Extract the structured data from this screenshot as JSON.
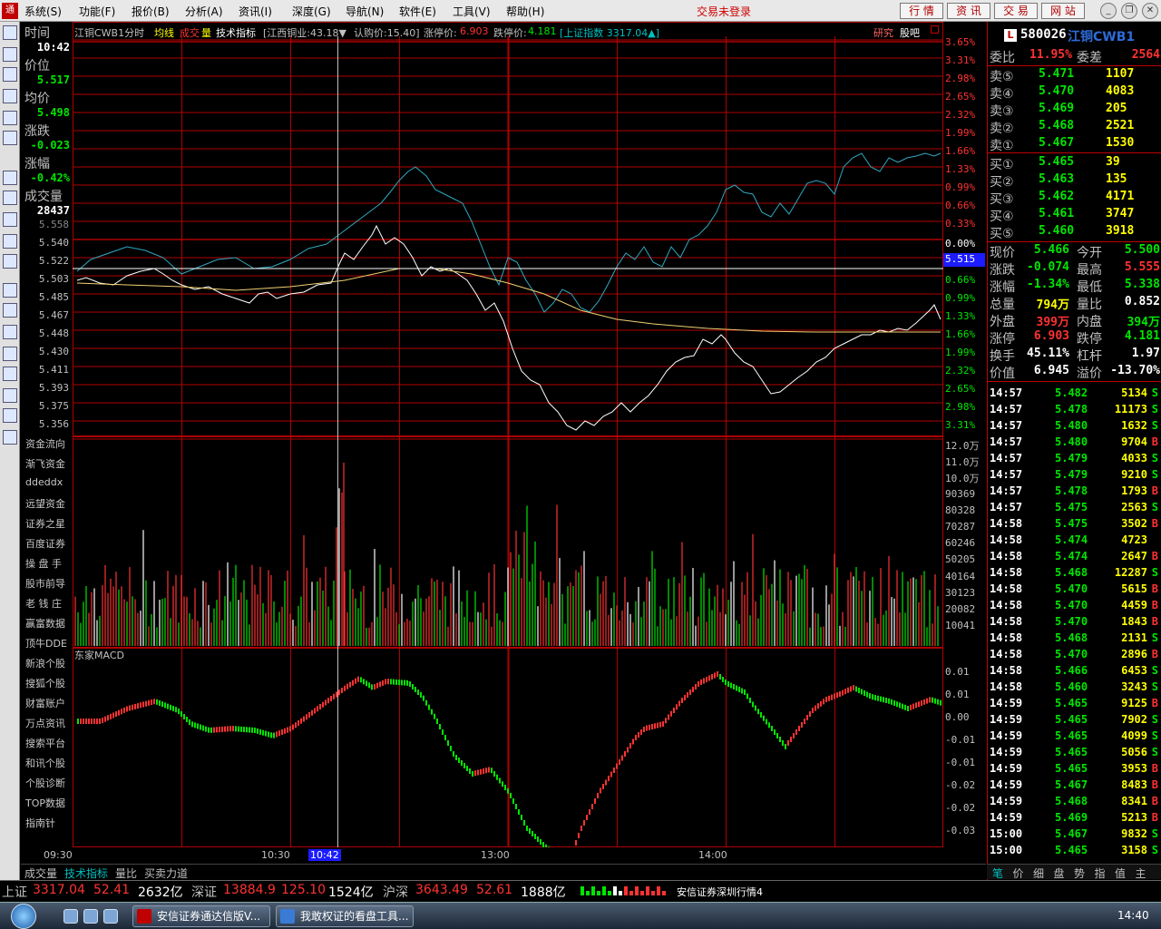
{
  "menubar": {
    "app_icon": "通",
    "items": [
      "系统(S)",
      "功能(F)",
      "报价(B)",
      "分析(A)",
      "资讯(I)",
      "深度(G)",
      "导航(N)",
      "软件(E)",
      "工具(V)",
      "帮助(H)"
    ],
    "trade_status": "交易未登录",
    "toolbar_buttons": [
      "行 情",
      "资 讯",
      "交 易",
      "网 站"
    ],
    "window_icons": [
      "minimize-icon",
      "restore-icon",
      "close-icon"
    ]
  },
  "colors": {
    "red": "#ff3232",
    "green": "#00e600",
    "yellow": "#ffff00",
    "white": "#ffffff",
    "cyan": "#00c0c0",
    "grid": "#b00000",
    "bg": "#000000"
  },
  "left_toolbar_icons": [
    "quote-icon",
    "list-icon",
    "minute-chart-icon",
    "kline-icon",
    "f10-icon",
    "report-icon",
    "mail-icon",
    "users-icon",
    "formula-icon",
    "search-icon",
    "etf-icon",
    "trend-icon",
    "compare-icon",
    "wave-icon",
    "percent-icon",
    "export-icon",
    "pen-icon",
    "up-arrow-icon",
    "down-arrow-icon"
  ],
  "side_values": [
    {
      "label": "时间",
      "value": "10:42"
    },
    {
      "label": "价位",
      "value": "5.517"
    },
    {
      "label": "均价",
      "value": "5.498"
    },
    {
      "label": "涨跌",
      "value": "-0.023"
    },
    {
      "label": "涨幅",
      "value": "-0.42%"
    },
    {
      "label": "成交量",
      "value": "28437"
    }
  ],
  "price_axis": [
    "5.558",
    "5.540",
    "5.522",
    "5.503",
    "5.485",
    "5.467",
    "5.448",
    "5.430",
    "5.411",
    "5.393",
    "5.375",
    "5.356"
  ],
  "indicator_links": [
    "资金流向",
    "渐飞资金",
    "ddeddx",
    "远望资金",
    "证券之星",
    "百度证券",
    "操 盘 手",
    "股市前导",
    "老 钱 庄",
    "赢富数据",
    "顶牛DDE",
    "新浪个股",
    "搜狐个股",
    "财富账户",
    "万点资讯",
    "搜索平台",
    "和讯个股",
    "个股诊断",
    "TOP数据",
    "指南针"
  ],
  "chart_header": {
    "name": "江铜CWB1分时",
    "avg_line": "均线",
    "volume_a": "成交",
    "volume_b": "量",
    "tech": "技术指标",
    "underlying": "[江西铜业:43.18▼",
    "strike": "认购价:15.40]",
    "limit_up_label": "涨停价:",
    "limit_up": "6.903",
    "limit_down_label": "跌停价:",
    "limit_down": "4.181",
    "index": "[上证指数 3317.04▲]",
    "research": "研究",
    "forum": "股吧"
  },
  "pct_axis_up": [
    "3.65%",
    "3.31%",
    "2.98%",
    "2.65%",
    "2.32%",
    "1.99%",
    "1.66%",
    "1.33%",
    "0.99%",
    "0.66%",
    "0.33%"
  ],
  "pct_axis_zero": "0.00%",
  "pct_axis_down": [
    "0.66%",
    "0.99%",
    "1.33%",
    "1.66%",
    "1.99%",
    "2.32%",
    "2.65%",
    "2.98%",
    "3.31%"
  ],
  "current_price_marker": "5.515",
  "volume_axis": [
    "12.0万",
    "11.0万",
    "10.0万",
    "90369",
    "80328",
    "70287",
    "60246",
    "50205",
    "40164",
    "30123",
    "20082",
    "10041"
  ],
  "macd_title": "东家MACD",
  "macd_axis": [
    "0.01",
    "0.01",
    "0.00",
    "-0.01",
    "-0.01",
    "-0.02",
    "-0.02",
    "-0.03"
  ],
  "time_axis": {
    "t1": "09:30",
    "t2": "10:30",
    "cursor": "10:42",
    "t3": "13:00",
    "t4": "14:00"
  },
  "bottom_tabs": [
    "成交量",
    "技术指标",
    "量比",
    "买卖力道"
  ],
  "quote": {
    "code": "580026",
    "name": "江铜CWB1",
    "logo": "L",
    "weibi_label": "委比",
    "weibi": "11.95%",
    "weicha_label": "委差",
    "weicha": "2564",
    "asks": [
      {
        "label": "卖⑤",
        "price": "5.471",
        "vol": "1107"
      },
      {
        "label": "卖④",
        "price": "5.470",
        "vol": "4083"
      },
      {
        "label": "卖③",
        "price": "5.469",
        "vol": "205"
      },
      {
        "label": "卖②",
        "price": "5.468",
        "vol": "2521"
      },
      {
        "label": "卖①",
        "price": "5.467",
        "vol": "1530"
      }
    ],
    "bids": [
      {
        "label": "买①",
        "price": "5.465",
        "vol": "39"
      },
      {
        "label": "买②",
        "price": "5.463",
        "vol": "135"
      },
      {
        "label": "买③",
        "price": "5.462",
        "vol": "4171"
      },
      {
        "label": "买④",
        "price": "5.461",
        "vol": "3747"
      },
      {
        "label": "买⑤",
        "price": "5.460",
        "vol": "3918"
      }
    ],
    "stats": [
      {
        "l1": "现价",
        "v1": "5.466",
        "l2": "今开",
        "v2": "5.500",
        "c1": "green",
        "c2": "green"
      },
      {
        "l1": "涨跌",
        "v1": "-0.074",
        "l2": "最高",
        "v2": "5.555",
        "c1": "green",
        "c2": "red"
      },
      {
        "l1": "涨幅",
        "v1": "-1.34%",
        "l2": "最低",
        "v2": "5.338",
        "c1": "green",
        "c2": "green"
      },
      {
        "l1": "总量",
        "v1": "794万",
        "l2": "量比",
        "v2": "0.852",
        "c1": "yellow",
        "c2": "white"
      },
      {
        "l1": "外盘",
        "v1": "399万",
        "l2": "内盘",
        "v2": "394万",
        "c1": "red",
        "c2": "green"
      },
      {
        "l1": "涨停",
        "v1": "6.903",
        "l2": "跌停",
        "v2": "4.181",
        "c1": "red",
        "c2": "green"
      },
      {
        "l1": "换手",
        "v1": "45.11%",
        "l2": "杠杆",
        "v2": "1.97",
        "c1": "white",
        "c2": "white"
      },
      {
        "l1": "价值",
        "v1": "6.945",
        "l2": "溢价",
        "v2": "-13.70%",
        "c1": "white",
        "c2": "white"
      }
    ],
    "ticks": [
      {
        "t": "14:57",
        "p": "5.482",
        "v": "5134",
        "s": "S"
      },
      {
        "t": "14:57",
        "p": "5.478",
        "v": "11173",
        "s": "S"
      },
      {
        "t": "14:57",
        "p": "5.480",
        "v": "1632",
        "s": "S"
      },
      {
        "t": "14:57",
        "p": "5.480",
        "v": "9704",
        "s": "B"
      },
      {
        "t": "14:57",
        "p": "5.479",
        "v": "4033",
        "s": "S"
      },
      {
        "t": "14:57",
        "p": "5.479",
        "v": "9210",
        "s": "S"
      },
      {
        "t": "14:57",
        "p": "5.478",
        "v": "1793",
        "s": "B"
      },
      {
        "t": "14:57",
        "p": "5.475",
        "v": "2563",
        "s": "S"
      },
      {
        "t": "14:58",
        "p": "5.475",
        "v": "3502",
        "s": "B"
      },
      {
        "t": "14:58",
        "p": "5.474",
        "v": "4723",
        "s": ""
      },
      {
        "t": "14:58",
        "p": "5.474",
        "v": "2647",
        "s": "B"
      },
      {
        "t": "14:58",
        "p": "5.468",
        "v": "12287",
        "s": "S"
      },
      {
        "t": "14:58",
        "p": "5.470",
        "v": "5615",
        "s": "B"
      },
      {
        "t": "14:58",
        "p": "5.470",
        "v": "4459",
        "s": "B"
      },
      {
        "t": "14:58",
        "p": "5.470",
        "v": "1843",
        "s": "B"
      },
      {
        "t": "14:58",
        "p": "5.468",
        "v": "2131",
        "s": "S"
      },
      {
        "t": "14:58",
        "p": "5.470",
        "v": "2896",
        "s": "B"
      },
      {
        "t": "14:58",
        "p": "5.466",
        "v": "6453",
        "s": "S"
      },
      {
        "t": "14:58",
        "p": "5.460",
        "v": "3243",
        "s": "S"
      },
      {
        "t": "14:59",
        "p": "5.465",
        "v": "9125",
        "s": "B"
      },
      {
        "t": "14:59",
        "p": "5.465",
        "v": "7902",
        "s": "S"
      },
      {
        "t": "14:59",
        "p": "5.465",
        "v": "4099",
        "s": "S"
      },
      {
        "t": "14:59",
        "p": "5.465",
        "v": "5056",
        "s": "S"
      },
      {
        "t": "14:59",
        "p": "5.465",
        "v": "3953",
        "s": "B"
      },
      {
        "t": "14:59",
        "p": "5.467",
        "v": "8483",
        "s": "B"
      },
      {
        "t": "14:59",
        "p": "5.468",
        "v": "8341",
        "s": "B"
      },
      {
        "t": "14:59",
        "p": "5.469",
        "v": "5213",
        "s": "B"
      },
      {
        "t": "15:00",
        "p": "5.467",
        "v": "9832",
        "s": "S"
      },
      {
        "t": "15:00",
        "p": "5.465",
        "v": "3158",
        "s": "S"
      }
    ]
  },
  "right_tabs": [
    "笔",
    "价",
    "细",
    "盘",
    "势",
    "指",
    "值",
    "主"
  ],
  "statusbar": {
    "sh_label": "上证",
    "sh_val": "3317.04",
    "sh_chg": "52.41",
    "sh_amt": "2632亿",
    "sz_label": "深证",
    "sz_val": "13884.9",
    "sz_chg": "125.10",
    "sz_amt": "1524亿",
    "hs_label": "沪深",
    "hs_val": "3643.49",
    "hs_chg": "52.61",
    "hs_amt": "1888亿",
    "broker": "安信证券深圳行情4"
  },
  "taskbar": {
    "items": [
      "安信证券通达信版V...",
      "我敢权证的看盘工具..."
    ],
    "clock": "14:40"
  }
}
